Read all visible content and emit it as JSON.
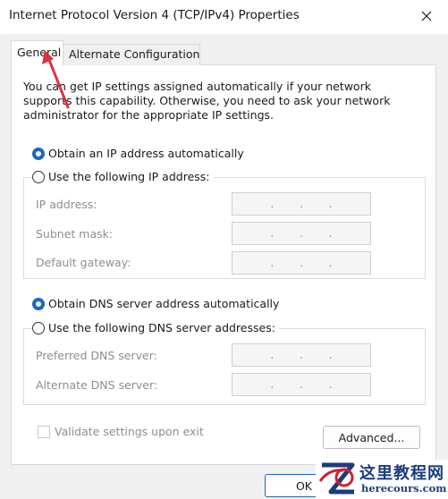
{
  "window": {
    "title": "Internet Protocol Version 4 (TCP/IPv4) Properties",
    "close_icon": "close-icon"
  },
  "tabs": [
    {
      "label": "General",
      "selected": true
    },
    {
      "label": "Alternate Configuration",
      "selected": false
    }
  ],
  "description": "You can get IP settings assigned automatically if your network supports this capability. Otherwise, you need to ask your network administrator for the appropriate IP settings.",
  "ip": {
    "auto_label": "Obtain an IP address automatically",
    "auto_selected": true,
    "manual_label": "Use the following IP address:",
    "manual_selected": false,
    "fields": [
      {
        "label": "IP address:",
        "value": " .  .  . "
      },
      {
        "label": "Subnet mask:",
        "value": " .  .  . "
      },
      {
        "label": "Default gateway:",
        "value": " .  .  . "
      }
    ]
  },
  "dns": {
    "auto_label": "Obtain DNS server address automatically",
    "auto_selected": true,
    "manual_label": "Use the following DNS server addresses:",
    "manual_selected": false,
    "fields": [
      {
        "label": "Preferred DNS server:",
        "value": " .  .  . "
      },
      {
        "label": "Alternate DNS server:",
        "value": " .  .  . "
      }
    ]
  },
  "validate": {
    "label": "Validate settings upon exit",
    "checked": false,
    "enabled": false
  },
  "buttons": {
    "advanced": "Advanced...",
    "ok": "OK"
  },
  "annotation": {
    "arrow_color": "#e0303a"
  },
  "watermark": {
    "site_cn": "这里教程网",
    "site_url": "herecours.com"
  },
  "colors": {
    "accent": "#1a66c4",
    "disabled_text": "#8e8e8e",
    "watermark": "#1b3c7c"
  }
}
